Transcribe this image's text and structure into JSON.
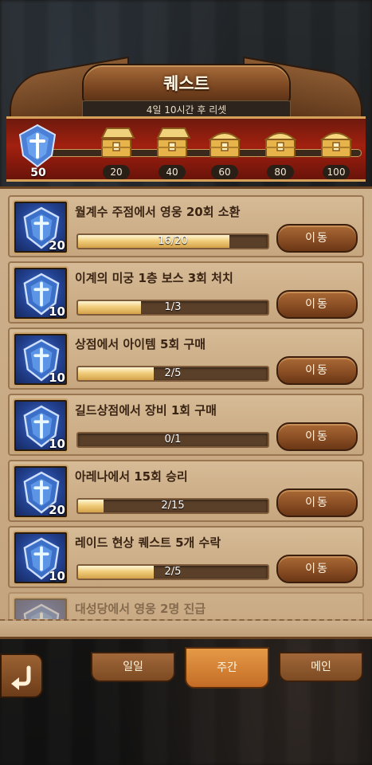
{
  "header": {
    "title": "퀘스트",
    "reset_text": "4일 10시간 후 리셋"
  },
  "rewards": {
    "current_points": "50",
    "progress_fraction": 0.0,
    "milestones": [
      "20",
      "40",
      "60",
      "80",
      "100"
    ],
    "chest_states": [
      "open",
      "open",
      "closed",
      "closed",
      "closed"
    ]
  },
  "quests": [
    {
      "title": "월계수 주점에서 영웅 20회 소환",
      "points": "20",
      "progress": "16/20",
      "fraction": 0.8,
      "button": "이동"
    },
    {
      "title": "이계의 미궁 1층 보스 3회 처치",
      "points": "10",
      "progress": "1/3",
      "fraction": 0.333,
      "button": "이동"
    },
    {
      "title": "상점에서 아이템 5회 구매",
      "points": "10",
      "progress": "2/5",
      "fraction": 0.4,
      "button": "이동"
    },
    {
      "title": "길드상점에서 장비 1회 구매",
      "points": "10",
      "progress": "0/1",
      "fraction": 0.0,
      "button": "이동"
    },
    {
      "title": "아레나에서 15회 승리",
      "points": "20",
      "progress": "2/15",
      "fraction": 0.133,
      "button": "이동"
    },
    {
      "title": "레이드 현상 퀘스트 5개 수락",
      "points": "10",
      "progress": "2/5",
      "fraction": 0.4,
      "button": "이동"
    },
    {
      "title": "대성당에서 영웅 2명 진급",
      "points": "",
      "progress": "",
      "fraction": 0.0,
      "button": ""
    }
  ],
  "tabs": [
    "일일",
    "주간",
    "메인"
  ],
  "active_tab": "주간",
  "icons": {
    "back": "back-arrow-icon",
    "emblem": "shield-emblem-icon",
    "chest": "treasure-chest-icon"
  },
  "colors": {
    "accent": "#d6a25a",
    "band": "#a2200f",
    "panel": "#c4a47e"
  }
}
